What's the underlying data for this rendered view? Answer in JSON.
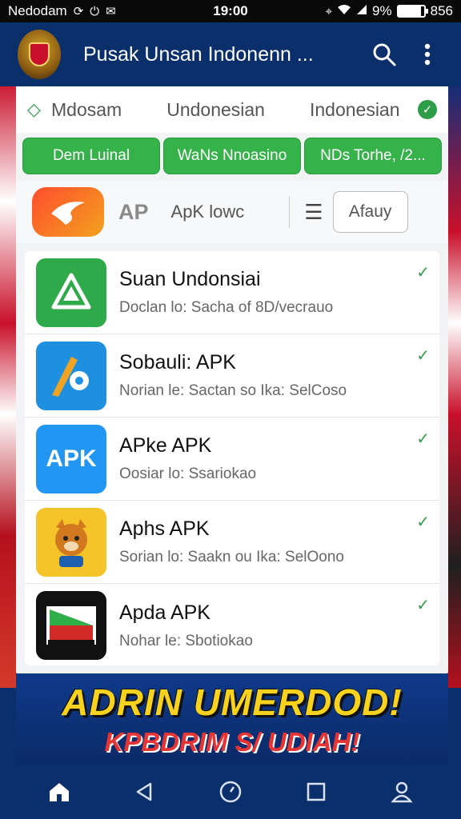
{
  "status_bar": {
    "carrier": "Nedodam",
    "time": "19:00",
    "battery": "9%",
    "battery_level": 0.9,
    "extra": "856"
  },
  "header": {
    "title": "Pusak Unsan Indonenn ..."
  },
  "filters": {
    "options": [
      "Mdosam",
      "Undonesian",
      "Indonesian"
    ]
  },
  "chips": [
    "Dem Luinal",
    "WaNs Nnoasino",
    "NDs Torhe, /2..."
  ],
  "brand": {
    "logo_text": "AP",
    "sub_text": "ApK lowc",
    "sort_label": "Afauy"
  },
  "apps": [
    {
      "name": "Suan Undonsiai",
      "desc": "Doclan lo: Sacha of 8D/vecrauo",
      "icon_color": "#2faa4a"
    },
    {
      "name": "Sobauli: APK",
      "desc": "Norian le: Sactan so Ika: SelCoso",
      "icon_color": "#1f8fe0"
    },
    {
      "name": "APke APK",
      "desc": "Oosiar lo: Ssariokao",
      "icon_color": "#2196f3",
      "icon_text": "APK"
    },
    {
      "name": "Aphs APK",
      "desc": "Sorian lo: Saakn ou Ika: SelOono",
      "icon_color": "#f5c32a"
    },
    {
      "name": "Apda APK",
      "desc": "Nohar le: Sbotiokao",
      "icon_color": "#111111"
    }
  ],
  "banner": {
    "title": "ADRIN UMERDOD!",
    "subtitle": "KPBDRIM S/ UDIAH!"
  },
  "colors": {
    "brand_blue": "#0b2f6b",
    "accent_green": "#36b24a",
    "banner_yellow": "#f7d21e",
    "banner_red": "#e63333"
  }
}
